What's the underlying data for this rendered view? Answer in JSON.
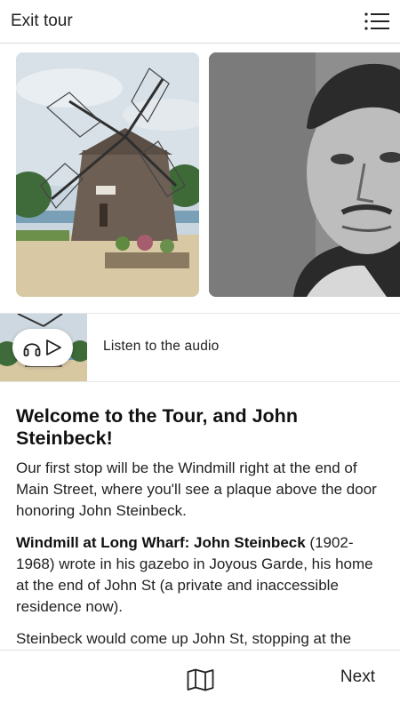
{
  "header": {
    "exit_label": "Exit tour",
    "menu_icon": "list-menu-icon"
  },
  "gallery": {
    "images": [
      {
        "name": "windmill-photo",
        "description": "Windmill at Long Wharf"
      },
      {
        "name": "john-steinbeck-portrait",
        "description": "John Steinbeck"
      }
    ]
  },
  "audio": {
    "label": "Listen to the audio",
    "icons": [
      "headphones-icon",
      "play-icon"
    ]
  },
  "article": {
    "title": "Welcome to the Tour, and John Steinbeck!",
    "paragraph1": "Our first stop will be the Windmill right at the end of Main Street, where you'll see a plaque above the door honoring John Steinbeck.",
    "paragraph2_bold": "Windmill at Long Wharf: John Steinbeck",
    "paragraph2_rest": " (1902-1968) wrote in his gazebo in Joyous Garde, his home at the end of John St (a private and inaccessible residence now).",
    "paragraph3": "Steinbeck would come up John St, stopping at the"
  },
  "footer": {
    "next_label": "Next",
    "map_icon": "map-icon"
  },
  "colors": {
    "text": "#111111",
    "divider": "#d9d9d9",
    "background": "#ffffff"
  }
}
